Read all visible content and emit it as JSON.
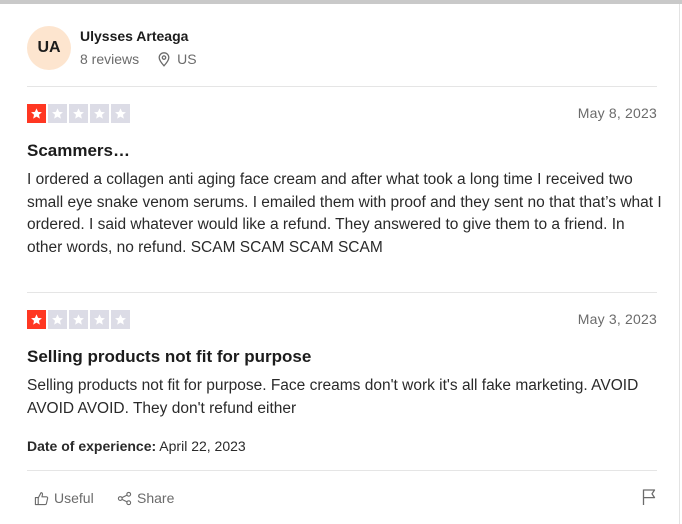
{
  "reviewer": {
    "initials": "UA",
    "name": "Ulysses Arteaga",
    "reviews_count": "8 reviews",
    "country": "US"
  },
  "reviews": [
    {
      "rating": 1,
      "max_rating": 5,
      "date": "May 8, 2023",
      "title": "Scammers…",
      "body": "I ordered a collagen anti aging face cream and after what took a long time I received two small eye snake venom serums. I emailed them with proof and they sent no that that’s what I ordered. I said whatever would like a refund. They answered to give them to a friend. In other words, no refund. SCAM SCAM SCAM SCAM"
    },
    {
      "rating": 1,
      "max_rating": 5,
      "date": "May 3, 2023",
      "title": "Selling products not fit for purpose",
      "body": "Selling products not fit for purpose. Face creams don't work it's all fake marketing. AVOID AVOID AVOID. They don't refund either",
      "experience_label": "Date of experience:",
      "experience_date": "April 22, 2023"
    }
  ],
  "actions": {
    "useful_label": "Useful",
    "share_label": "Share"
  },
  "colors": {
    "star_filled": "#ff3722",
    "star_empty": "#dcdce6",
    "avatar_bg": "#fde5cf"
  },
  "icons": [
    "location-icon",
    "thumbs-up-icon",
    "share-icon",
    "flag-icon",
    "star-icon"
  ]
}
